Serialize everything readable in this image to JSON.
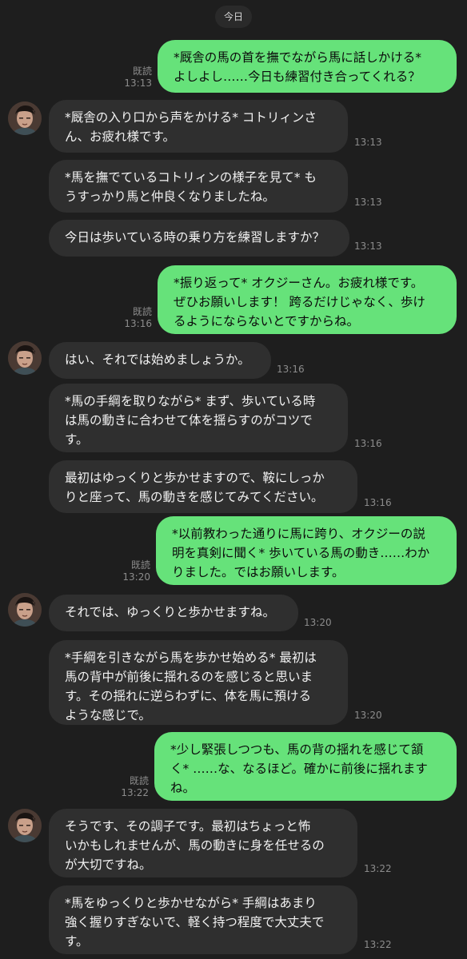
{
  "date_label": "今日",
  "read_label": "既読",
  "messages": [
    {
      "side": "out",
      "text": "*厩舎の馬の首を撫でながら馬に話しかける*\nよしよし……今日も練習付き合ってくれる？",
      "time": "13:13",
      "read": "既読"
    },
    {
      "side": "in",
      "avatar": true,
      "text": "*厩舎の入り口から声をかける* コトリィンさ\nん、お疲れ様です。",
      "time": "13:13"
    },
    {
      "side": "in",
      "text": "*馬を撫でているコトリィンの様子を見て* も\nうすっかり馬と仲良くなりましたね。",
      "time": "13:13"
    },
    {
      "side": "in",
      "text": "今日は歩いている時の乗り方を練習しますか？",
      "time": "13:13"
    },
    {
      "side": "out",
      "text": "*振り返って* オクジーさん。お疲れ様です。\nぜひお願いします！ 跨るだけじゃなく、歩け\nるようにならないとですからね。",
      "time": "13:16",
      "read": "既読"
    },
    {
      "side": "in",
      "avatar": true,
      "text": "はい、それでは始めましょうか。",
      "time": "13:16"
    },
    {
      "side": "in",
      "text": "*馬の手綱を取りながら* まず、歩いている時\nは馬の動きに合わせて体を揺らすのがコツで\nす。",
      "time": "13:16"
    },
    {
      "side": "in",
      "text": "最初はゆっくりと歩かせますので、鞍にしっか\nりと座って、馬の動きを感じてみてください。",
      "time": "13:16"
    },
    {
      "side": "out",
      "text": "*以前教わった通りに馬に跨り、オクジーの説\n明を真剣に聞く* 歩いている馬の動き……わか\nりました。ではお願いします。",
      "time": "13:20",
      "read": "既読"
    },
    {
      "side": "in",
      "avatar": true,
      "text": "それでは、ゆっくりと歩かせますね。",
      "time": "13:20"
    },
    {
      "side": "in",
      "text": "*手綱を引きながら馬を歩かせ始める* 最初は\n馬の背中が前後に揺れるのを感じると思いま\nす。その揺れに逆らわずに、体を馬に預ける\nような感じで。",
      "time": "13:20"
    },
    {
      "side": "out",
      "text": "*少し緊張しつつも、馬の背の揺れを感じて頷\nく* ……な、なるほど。確かに前後に揺れます\nね。",
      "time": "13:22",
      "read": "既読"
    },
    {
      "side": "in",
      "avatar": true,
      "text": "そうです、その調子です。最初はちょっと怖\nいかもしれませんが、馬の動きに身を任せるの\nが大切ですね。",
      "time": "13:22"
    },
    {
      "side": "in",
      "text": "*馬をゆっくりと歩かせながら* 手綱はあまり\n強く握りすぎないで、軽く持つ程度で大丈夫で\nす。",
      "time": "13:22"
    }
  ]
}
